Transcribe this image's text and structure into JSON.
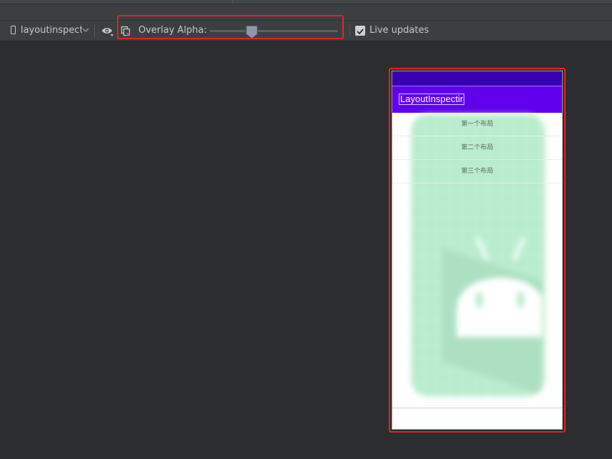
{
  "toolbar": {
    "device_label": "layoutinspectir",
    "overlay_alpha_label": "Overlay Alpha:",
    "overlay_alpha_value": 0.33,
    "live_updates_label": "Live updates",
    "live_updates_checked": true
  },
  "preview": {
    "app_title": "LayoutInspectir",
    "items": [
      "第一个布局",
      "第二个布局",
      "第三个布局"
    ],
    "colors": {
      "status_bar": "#3700b3",
      "app_bar": "#6200ee",
      "overlay": "#b7eccc"
    }
  },
  "colors": {
    "highlight": "#e0251d",
    "background": "#2b2d30"
  }
}
